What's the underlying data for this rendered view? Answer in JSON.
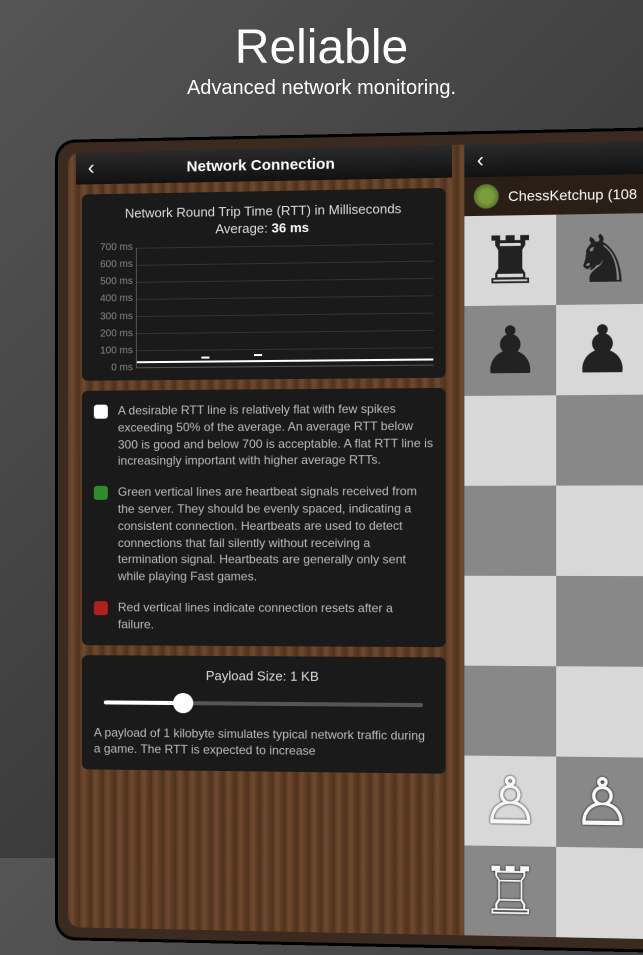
{
  "hero": {
    "title": "Reliable",
    "subtitle": "Advanced network monitoring."
  },
  "panel": {
    "header_title": "Network Connection",
    "rtt_card": {
      "title": "Network Round Trip Time (RTT) in Milliseconds",
      "avg_label": "Average:",
      "avg_value": "36 ms",
      "y_ticks": [
        "700 ms",
        "600 ms",
        "500 ms",
        "400 ms",
        "300 ms",
        "200 ms",
        "100 ms",
        "0 ms"
      ]
    },
    "legend": {
      "white": "A desirable RTT line is relatively flat with few spikes exceeding 50% of the average. An average RTT below 300 is good and below 700 is acceptable. A flat RTT line is increasingly important with higher average RTTs.",
      "green": "Green vertical lines are heartbeat signals received from the server. They should be evenly spaced, indicating a consistent connection. Heartbeats are used to detect connections that fail silently without receiving a termination signal. Heartbeats are generally only sent while playing Fast games.",
      "red": "Red vertical lines indicate connection resets after a failure."
    },
    "payload": {
      "title": "Payload Size: 1 KB",
      "desc": "A payload of 1 kilobyte simulates typical network traffic during a game. The RTT is expected to increase"
    }
  },
  "game": {
    "player": "ChessKetchup (108"
  },
  "chart_data": {
    "type": "line",
    "title": "Network Round Trip Time (RTT) in Milliseconds",
    "ylabel": "ms",
    "ylim": [
      0,
      700
    ],
    "series": [
      {
        "name": "RTT",
        "values": [
          36,
          36,
          36,
          42,
          36,
          36,
          36,
          50,
          36,
          36,
          36,
          36,
          36,
          36,
          36,
          36,
          36,
          36,
          36
        ]
      }
    ],
    "average": 36
  }
}
